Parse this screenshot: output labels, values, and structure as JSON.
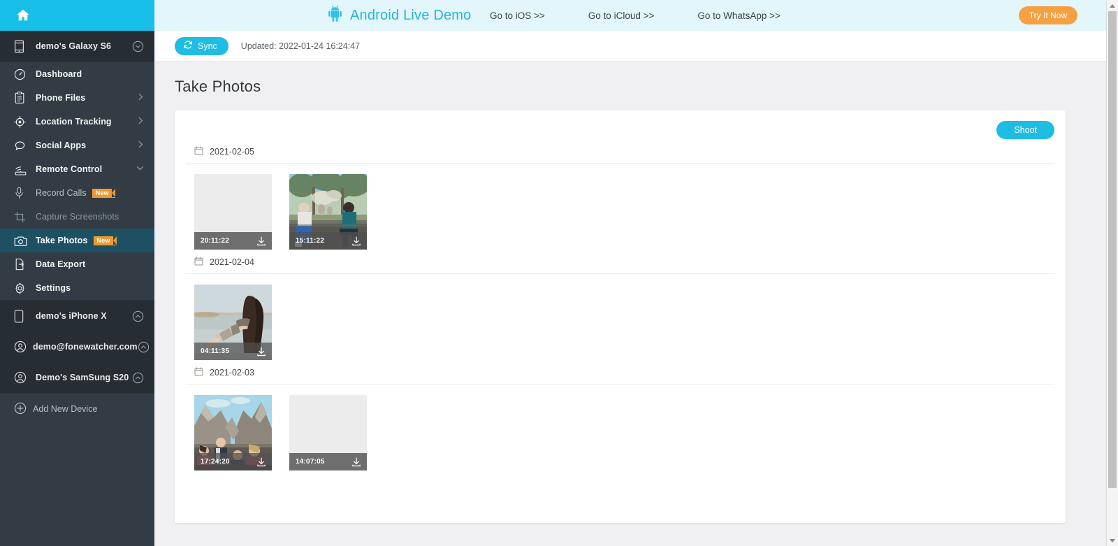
{
  "sidebar": {
    "home_icon": "home-icon",
    "primary_device": {
      "label": "demo's Galaxy S6",
      "icon": "phone-icon",
      "chevron": "chevron-down-icon"
    },
    "nav": [
      {
        "label": "Dashboard",
        "icon": "gauge-icon",
        "arrow": "",
        "state": "normal"
      },
      {
        "label": "Phone Files",
        "icon": "clipboard-icon",
        "arrow": "chevron-right-icon",
        "state": "normal"
      },
      {
        "label": "Location Tracking",
        "icon": "target-icon",
        "arrow": "chevron-right-icon",
        "state": "normal"
      },
      {
        "label": "Social Apps",
        "icon": "chat-bubble-icon",
        "arrow": "chevron-right-icon",
        "state": "normal"
      },
      {
        "label": "Remote Control",
        "icon": "remote-wifi-icon",
        "arrow": "chevron-down-icon",
        "state": "expanded"
      }
    ],
    "sub_nav": [
      {
        "label": "Record Calls",
        "icon": "microphone-icon",
        "badge": "New",
        "state": "sub"
      },
      {
        "label": "Capture Screenshots",
        "icon": "crop-icon",
        "badge": "",
        "state": "sub-dim"
      },
      {
        "label": "Take Photos",
        "icon": "camera-icon",
        "badge": "New",
        "state": "active"
      },
      {
        "label": "Data Export",
        "icon": "export-file-icon",
        "badge": "",
        "state": "normal"
      },
      {
        "label": "Settings",
        "icon": "gear-icon",
        "badge": "",
        "state": "normal"
      }
    ],
    "devices": [
      {
        "label": "demo's iPhone X",
        "icon": "tablet-icon",
        "chevron": "chevron-up-icon"
      },
      {
        "label": "demo@fonewatcher.com",
        "icon": "account-icon",
        "chevron": "chevron-up-icon"
      },
      {
        "label": "Demo's SamSung S20",
        "icon": "account-icon",
        "chevron": "chevron-up-icon"
      }
    ],
    "add_device": {
      "label": "Add New Device",
      "icon": "plus-circle-icon"
    }
  },
  "header": {
    "brand": "Android Live Demo",
    "brand_icon": "android-robot-icon",
    "links": [
      "Go to iOS >>",
      "Go to iCloud >>",
      "Go to WhatsApp >>"
    ],
    "cta": "Try It Now"
  },
  "syncbar": {
    "sync_label": "Sync",
    "sync_icon": "refresh-icon",
    "updated": "Updated: 2022-01-24 16:24:47"
  },
  "page": {
    "title": "Take Photos",
    "shoot_label": "Shoot"
  },
  "groups": [
    {
      "date": "2021-02-05",
      "date_icon": "calendar-icon",
      "photos": [
        {
          "time": "20:11:22",
          "style": "blank",
          "download_icon": "download-icon"
        },
        {
          "time": "15:11:22",
          "style": "park",
          "download_icon": "download-icon"
        }
      ]
    },
    {
      "date": "2021-02-04",
      "date_icon": "calendar-icon",
      "photos": [
        {
          "time": "04:11:35",
          "style": "beach",
          "download_icon": "download-icon"
        }
      ]
    },
    {
      "date": "2021-02-03",
      "date_icon": "calendar-icon",
      "photos": [
        {
          "time": "17:24:20",
          "style": "mtn",
          "download_icon": "download-icon"
        },
        {
          "time": "14:07:05",
          "style": "blank",
          "download_icon": "download-icon"
        }
      ]
    }
  ],
  "colors": {
    "accent_cyan": "#1fbde4",
    "sidebar_bg": "#333c44",
    "sidebar_dark": "#262d33",
    "active_item": "#1d5062",
    "badge_orange": "#f0992f",
    "cta_orange": "#f5a142",
    "header_bg": "#e2f6fb",
    "brand_text": "#25b3e0"
  }
}
